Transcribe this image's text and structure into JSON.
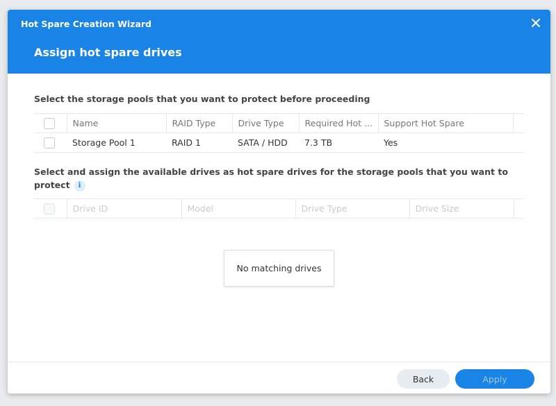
{
  "window": {
    "title": "Hot Spare Creation Wizard",
    "close_icon": "close-icon"
  },
  "step": {
    "title": "Assign hot spare drives"
  },
  "pools_section": {
    "title": "Select the storage pools that you want to protect before proceeding",
    "columns": [
      "Name",
      "RAID Type",
      "Drive Type",
      "Required Hot ...",
      "Support Hot Spare"
    ],
    "rows": [
      {
        "name": "Storage Pool 1",
        "raid_type": "RAID 1",
        "drive_type": "SATA / HDD",
        "required_hot": "7.3 TB",
        "support_hot_spare": "Yes",
        "checked": false
      }
    ]
  },
  "drives_section": {
    "title_line1": "Select and assign the available drives as hot spare drives for the storage pools that you want to",
    "title_line2": "protect",
    "info_icon": "info-icon",
    "columns": [
      "Drive ID",
      "Model",
      "Drive Type",
      "Drive Size"
    ],
    "rows": [],
    "empty_text": "No matching drives",
    "disabled": true
  },
  "footer": {
    "back_label": "Back",
    "apply_label": "Apply",
    "apply_enabled": false
  },
  "colors": {
    "accent": "#1a84e6",
    "header_text": "#ffffff",
    "disabled_text": "#c8cbd0"
  }
}
